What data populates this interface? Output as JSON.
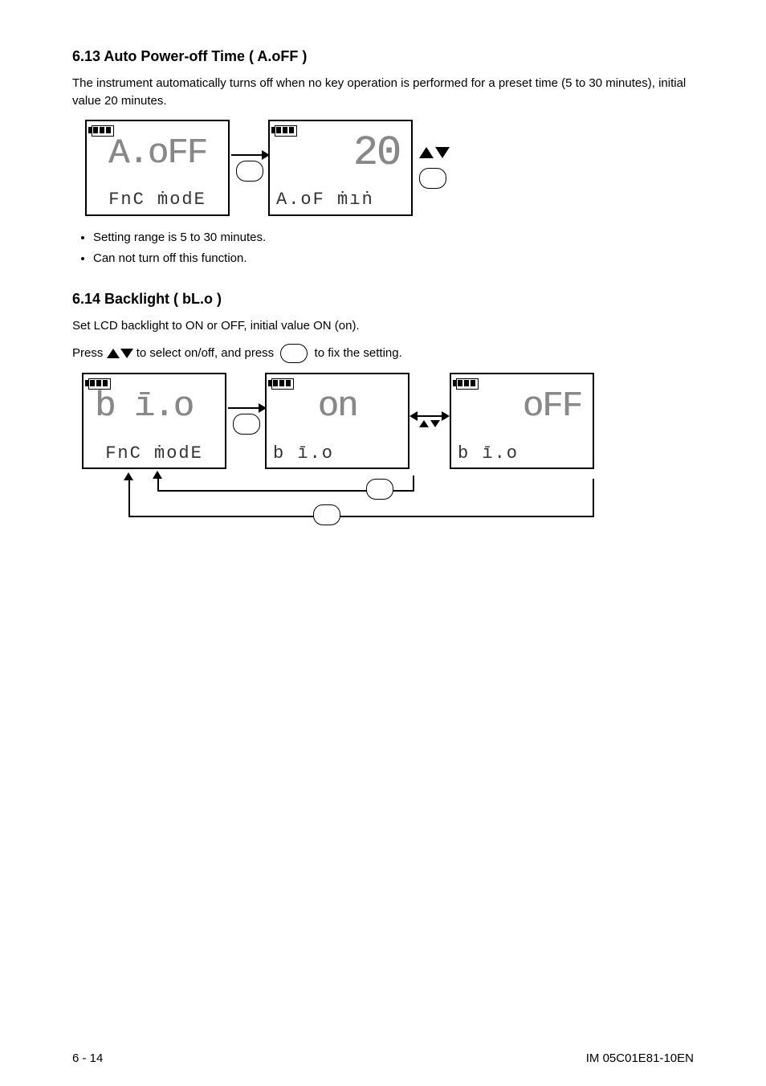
{
  "title1": "6.13 Auto Power-off Time ( A.oFF )",
  "desc1": "The instrument automatically turns off when no key operation is performed for a preset time (5 to 30 minutes), initial value 20 minutes.",
  "bullet1a": "Setting range is 5 to 30 minutes.",
  "bullet1b": "Can not turn off this function.",
  "lcd1_main": "A.oFF",
  "lcd1_sub": "FnC ṁodE",
  "lcd2_main": "20",
  "lcd2_sub": "A.oF     ṁıṅ",
  "title2": "6.14 Backlight ( bL.o )",
  "desc2_p1": "Set LCD backlight to ON or OFF, initial value ON (on).",
  "desc2_p2a": "Press ",
  "desc2_p2b": " to select on/off, and press ",
  "desc2_p2c": " to fix the setting.",
  "lcd3_main": "b ī.o",
  "lcd3_sub": "FnC ṁodE",
  "lcd4_main": "on",
  "lcd4_sub": "b ī.o",
  "lcd5_main": "oFF",
  "lcd5_sub": "b ī.o",
  "footer_left": "6 - 14",
  "footer_right": "IM 05C01E81-10EN"
}
